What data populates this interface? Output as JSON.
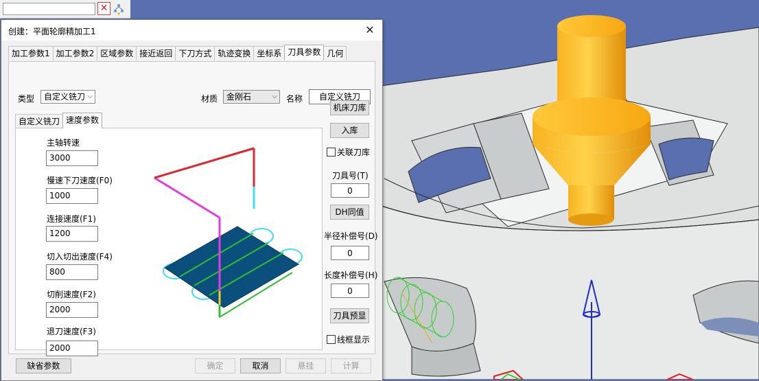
{
  "window": {
    "title": "创建：平面轮廓精加工1",
    "close_glyph": "✕"
  },
  "main_tabs": [
    {
      "label": "加工参数1"
    },
    {
      "label": "加工参数2"
    },
    {
      "label": "区域参数"
    },
    {
      "label": "接近返回"
    },
    {
      "label": "下刀方式"
    },
    {
      "label": "轨迹变换"
    },
    {
      "label": "坐标系"
    },
    {
      "label": "刀具参数",
      "active": true
    },
    {
      "label": "几何"
    }
  ],
  "tool": {
    "type_label": "类型",
    "type_value": "自定义铣刀",
    "material_label": "材质",
    "material_value": "金刚石",
    "name_label": "名称",
    "name_value": "自定义铣刀"
  },
  "sub_tabs": [
    {
      "label": "自定义铣刀"
    },
    {
      "label": "速度参数",
      "active": true
    }
  ],
  "speed": {
    "spindle_label": "主轴转速",
    "spindle_value": "3000",
    "slow_down_label": "慢速下刀速度(F0)",
    "slow_down_value": "1000",
    "link_label": "连接速度(F1)",
    "link_value": "1200",
    "in_out_label": "切入切出速度(F4)",
    "in_out_value": "800",
    "cut_label": "切削速度(F2)",
    "cut_value": "2000",
    "retract_label": "退刀速度(F3)",
    "retract_value": "2000"
  },
  "right_panel": {
    "machine_lib_button": "机床刀库",
    "store_button": "入库",
    "link_lib_checkbox": "关联刀库",
    "tool_no_label": "刀具号(T)",
    "tool_no_value": "0",
    "dh_same_button": "DH同值",
    "radius_comp_label": "半径补偿号(D)",
    "radius_comp_value": "0",
    "length_comp_label": "长度补偿号(H)",
    "length_comp_value": "0",
    "preview_button": "刀具预显",
    "wireframe_checkbox": "线框显示"
  },
  "footer": {
    "default_button": "缺省参数",
    "ok_button": "确定",
    "cancel_button": "取消",
    "suspend_button": "悬挂",
    "compute_button": "计算"
  },
  "colors": {
    "viewport_bg": "#5a6fb0",
    "part_gray": "#e6e8e8",
    "tool_gold": "#f6ad1c",
    "toolpath_fill": "#0b4f7c",
    "arc_cyan": "#3de0f2",
    "approach_magenta": "#e53be3",
    "retract_red": "#e0262d",
    "axis_blue": "#1c2bd8"
  },
  "icons": {
    "clear_icon": "x-icon",
    "tree_icon": "tree-icon"
  }
}
